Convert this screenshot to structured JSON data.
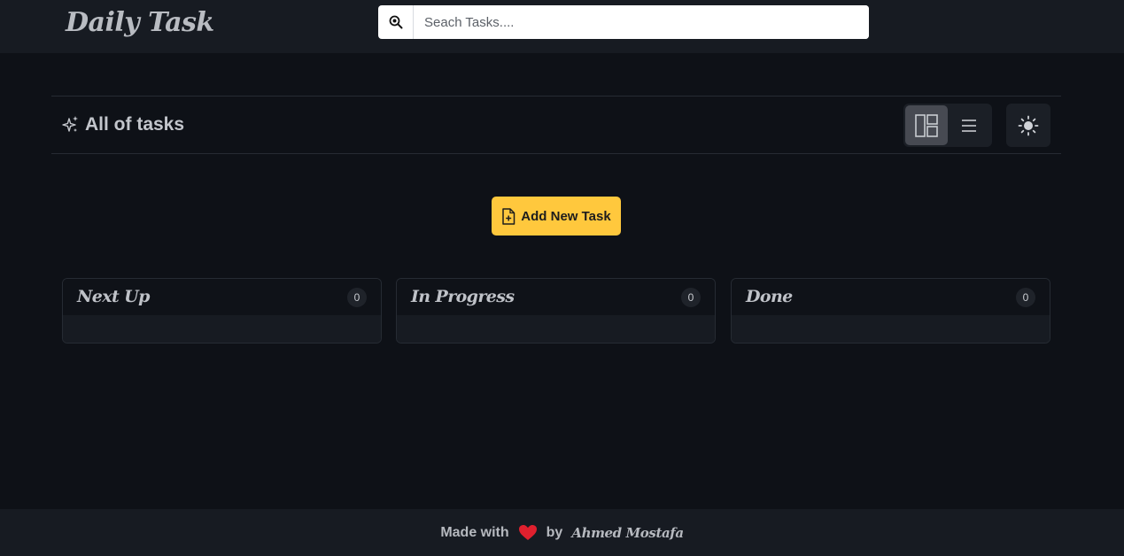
{
  "app": {
    "brand": "Daily Task"
  },
  "search": {
    "placeholder": "Seach Tasks....",
    "value": ""
  },
  "toolbar": {
    "heading": "All of tasks",
    "views": [
      {
        "name": "board-view",
        "icon": "board-layout-icon",
        "active": true
      },
      {
        "name": "list-view",
        "icon": "list-icon",
        "active": false
      }
    ],
    "theme_icon": "sun-icon"
  },
  "actions": {
    "add_task_label": "Add New Task"
  },
  "columns": [
    {
      "title": "Next Up",
      "count": "0"
    },
    {
      "title": "In Progress",
      "count": "0"
    },
    {
      "title": "Done",
      "count": "0"
    }
  ],
  "footer": {
    "made_with": "Made with",
    "by": "by",
    "author": "Ahmed Mostafa"
  },
  "colors": {
    "accent": "#ffc83d",
    "heart": "#e0202e",
    "background": "#0e1117",
    "surface": "#171b22"
  }
}
